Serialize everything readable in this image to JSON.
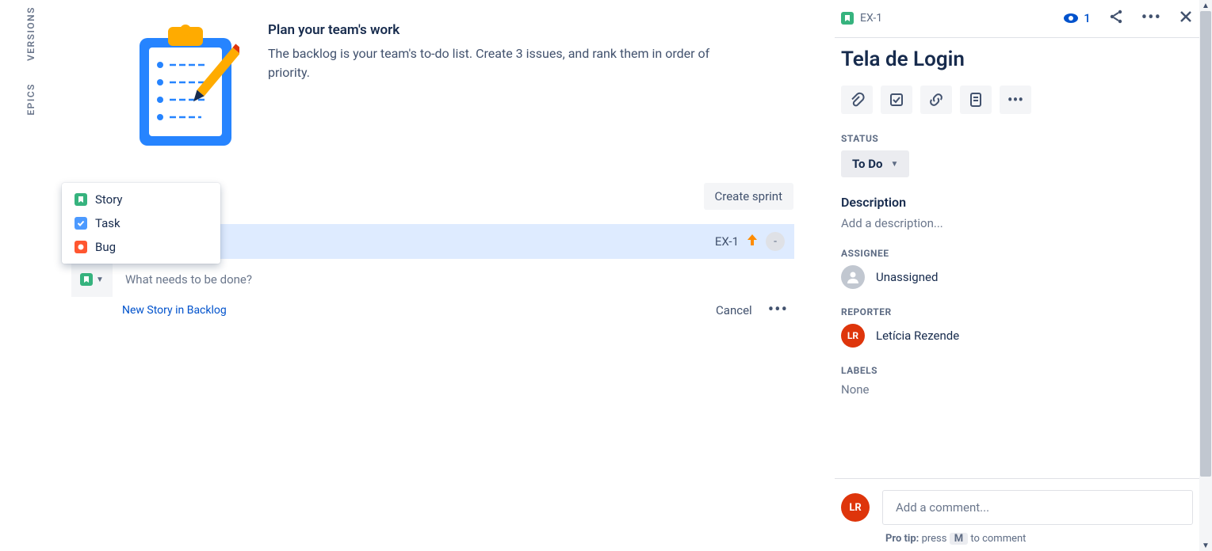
{
  "vtabs": {
    "versions": "VERSIONS",
    "epics": "EPICS"
  },
  "emptyState": {
    "title": "Plan your team's work",
    "body": "The backlog is your team's to-do list. Create 3 issues, and rank them in order of priority."
  },
  "typePopup": {
    "story": "Story",
    "task": "Task",
    "bug": "Bug"
  },
  "backlog": {
    "createSprint": "Create sprint",
    "selectedRow": {
      "key": "EX-1",
      "assigneePlaceholder": "-"
    },
    "inlineCreate": {
      "placeholder": "What needs to be done?",
      "helper": "New Story in Backlog",
      "cancel": "Cancel"
    }
  },
  "detail": {
    "key": "EX-1",
    "watchCount": "1",
    "title": "Tela de Login",
    "statusLabel": "STATUS",
    "statusValue": "To Do",
    "descriptionLabel": "Description",
    "descriptionPlaceholder": "Add a description...",
    "assigneeLabel": "ASSIGNEE",
    "assigneeValue": "Unassigned",
    "reporterLabel": "REPORTER",
    "reporterName": "Letícia Rezende",
    "reporterInitials": "LR",
    "labelsLabel": "LABELS",
    "labelsValue": "None",
    "commentPlaceholder": "Add a comment...",
    "proTipPrefix": "Pro tip:",
    "proTipPress": "press",
    "proTipKey": "M",
    "proTipSuffix": "to comment",
    "commenterInitials": "LR"
  }
}
